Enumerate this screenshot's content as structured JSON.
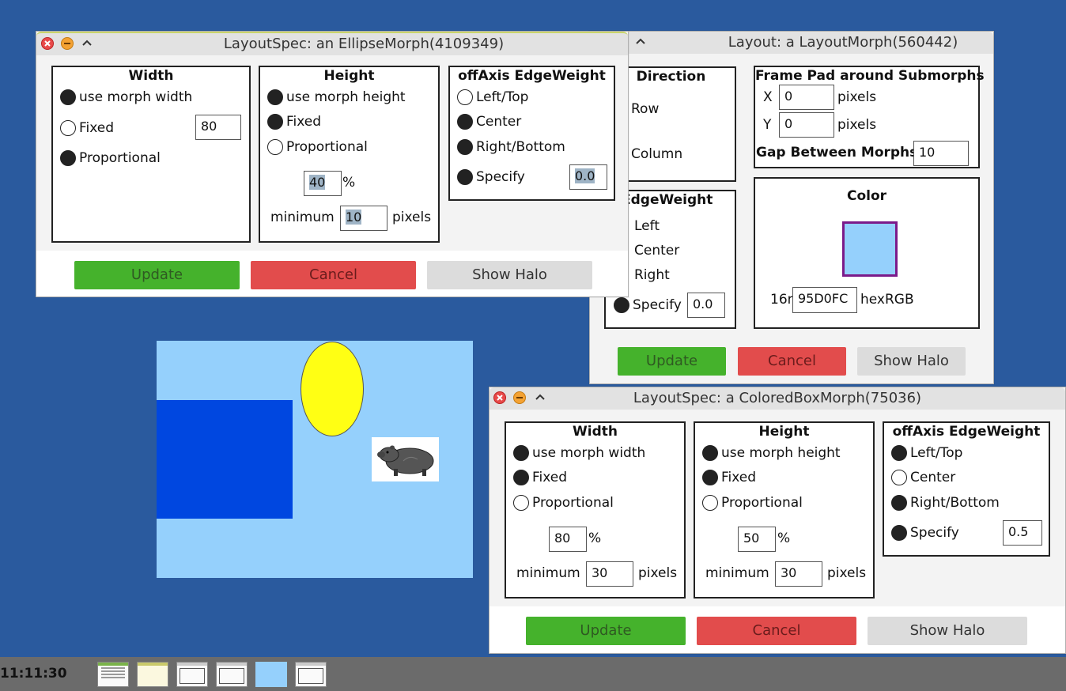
{
  "windows": {
    "ellipse": {
      "title": "LayoutSpec: an EllipseMorph(4109349)",
      "width": {
        "header": "Width",
        "opt_morph": "use morph width",
        "opt_fixed": "Fixed",
        "opt_prop": "Proportional",
        "fixed_value": "80"
      },
      "height": {
        "header": "Height",
        "opt_morph": "use morph height",
        "opt_fixed": "Fixed",
        "opt_prop": "Proportional",
        "percent_value": "40",
        "percent_sign": "%",
        "min_label": "minimum",
        "min_value": "10",
        "pixels_label": "pixels"
      },
      "offaxis": {
        "header": "offAxis EdgeWeight",
        "opt_left": "Left/Top",
        "opt_center": "Center",
        "opt_right": "Right/Bottom",
        "opt_specify": "Specify",
        "specify_value": "0.0"
      },
      "buttons": {
        "update": "Update",
        "cancel": "Cancel",
        "halo": "Show Halo"
      }
    },
    "layout": {
      "title": "Layout: a LayoutMorph(560442)",
      "direction": {
        "header": "Direction",
        "opt_row": "Row",
        "opt_column": "Column"
      },
      "framepad": {
        "header": "Frame Pad around Submorphs",
        "x_label": "X",
        "x_value": "0",
        "x_unit": "pixels",
        "y_label": "Y",
        "y_value": "0",
        "y_unit": "pixels",
        "gap_label": "Gap Between Morphs",
        "gap_value": "10"
      },
      "edgeweight": {
        "header": "EdgeWeight",
        "opt_left": "Left",
        "opt_center": "Center",
        "opt_right": "Right",
        "opt_specify": "Specify",
        "specify_value": "0.0"
      },
      "color": {
        "header": "Color",
        "swatch_hex": "#95D0FC",
        "prefix": "16r",
        "hex_value": "95D0FC",
        "suffix": "hexRGB"
      },
      "buttons": {
        "update": "Update",
        "cancel": "Cancel",
        "halo": "Show Halo"
      }
    },
    "coloredbox": {
      "title": "LayoutSpec: a ColoredBoxMorph(75036)",
      "width": {
        "header": "Width",
        "opt_morph": "use morph width",
        "opt_fixed": "Fixed",
        "opt_prop": "Proportional",
        "percent_value": "80",
        "percent_sign": "%",
        "min_label": "minimum",
        "min_value": "30",
        "pixels_label": "pixels"
      },
      "height": {
        "header": "Height",
        "opt_morph": "use morph height",
        "opt_fixed": "Fixed",
        "opt_prop": "Proportional",
        "percent_value": "50",
        "percent_sign": "%",
        "min_label": "minimum",
        "min_value": "30",
        "pixels_label": "pixels"
      },
      "offaxis": {
        "header": "offAxis EdgeWeight",
        "opt_left": "Left/Top",
        "opt_center": "Center",
        "opt_right": "Right/Bottom",
        "opt_specify": "Specify",
        "specify_value": "0.5"
      },
      "buttons": {
        "update": "Update",
        "cancel": "Cancel",
        "halo": "Show Halo"
      }
    }
  },
  "canvas": {
    "background": "#95D0FC",
    "box_color": "#0047E0",
    "ellipse_color": "#FFFF14",
    "image_icon": "capybara-icon"
  },
  "taskbar": {
    "clock": "11:11:30"
  },
  "colors": {
    "desktop": "#2A5A9E",
    "update": "#45B22C",
    "cancel": "#E24C4C",
    "halo": "#DCDCDC"
  }
}
